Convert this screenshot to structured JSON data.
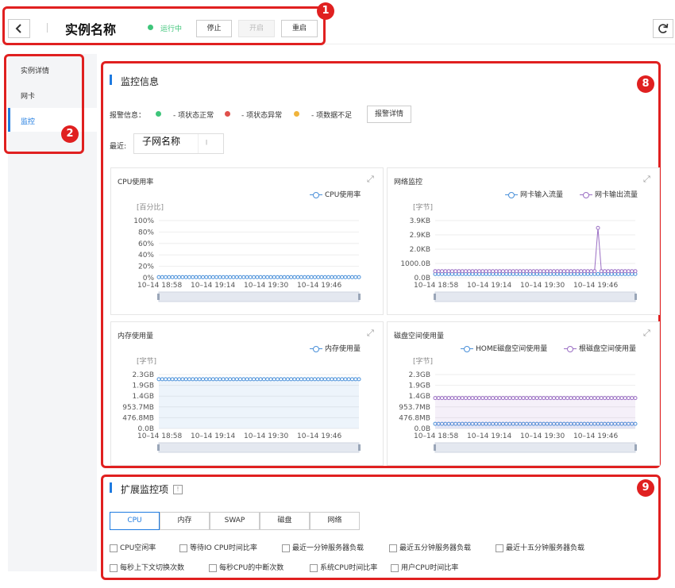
{
  "header": {
    "title": "实例名称",
    "status": "运行中",
    "status_color": "#3ec57a",
    "buttons": [
      "停止",
      "开启",
      "重启"
    ],
    "back_icon": "chevron-left-icon",
    "refresh_icon": "refresh-icon"
  },
  "sidebar": {
    "items": [
      {
        "label": "实例详情",
        "active": false
      },
      {
        "label": "网卡",
        "active": false
      },
      {
        "label": "监控",
        "active": true
      }
    ],
    "accent": "#1f7be0"
  },
  "badges": [
    "1",
    "2",
    "8",
    "9"
  ],
  "monitor": {
    "title": "监控信息",
    "alarm_label": "报警信息：",
    "legend": [
      {
        "text": "- 项状态正常",
        "color": "#3ec57a"
      },
      {
        "text": "- 项状态异常",
        "color": "#e0504b"
      },
      {
        "text": "- 项数据不足",
        "color": "#f0b43c"
      }
    ],
    "alarm_button": "报警详情",
    "recent_label": "最近:",
    "subnet_value": "子网名称"
  },
  "chart_data": [
    {
      "type": "line",
      "title": "CPU使用率",
      "ylabel": "[百分比]",
      "yticks": [
        "100%",
        "80%",
        "60%",
        "40%",
        "20%",
        "0%"
      ],
      "ylim": [
        0,
        100
      ],
      "x": [
        "10–14 18:58",
        "10–14 19:14",
        "10–14 19:30",
        "10–14 19:46"
      ],
      "series": [
        {
          "name": "CPU使用率",
          "color": "#4a90d9",
          "values": [
            1,
            1,
            1,
            1,
            1,
            1,
            1,
            1,
            1,
            1,
            1,
            1,
            1,
            1,
            1,
            1,
            1,
            1,
            1,
            1,
            1,
            1,
            1,
            1,
            1,
            1,
            1,
            1,
            1,
            1,
            1,
            1,
            1,
            1,
            1,
            1,
            1,
            1,
            1,
            1,
            1,
            1,
            1,
            1,
            1,
            1,
            1,
            1,
            1,
            1,
            1,
            1,
            1,
            1,
            1,
            1,
            1,
            1,
            1,
            1
          ]
        }
      ]
    },
    {
      "type": "line",
      "title": "网络监控",
      "ylabel": "[字节]",
      "yticks": [
        "3.9KB",
        "2.9KB",
        "2.0KB",
        "1000.0B",
        "0.0B"
      ],
      "ylim": [
        0,
        3.9
      ],
      "x": [
        "10–14 18:58",
        "10–14 19:14",
        "10–14 19:30",
        "10–14 19:46"
      ],
      "series": [
        {
          "name": "网卡输入流量",
          "color": "#4a90d9",
          "values": [
            0.25,
            0.25,
            0.25,
            0.25,
            0.25,
            0.25,
            0.25,
            0.25,
            0.25,
            0.25,
            0.25,
            0.25,
            0.25,
            0.25,
            0.25,
            0.25,
            0.25,
            0.25,
            0.25,
            0.25,
            0.25,
            0.25,
            0.25,
            0.25,
            0.25,
            0.25,
            0.25,
            0.25,
            0.25,
            0.25,
            0.25,
            0.25,
            0.25,
            0.25,
            0.25,
            0.25,
            0.25,
            0.25,
            0.25,
            0.25,
            0.25,
            0.25,
            0.25,
            0.25,
            0.25,
            0.25,
            0.25,
            0.25,
            0.25,
            0.25,
            0.25,
            0.25,
            0.25,
            0.25,
            0.25,
            0.25,
            0.25,
            0.25,
            0.25,
            0.25
          ]
        },
        {
          "name": "网卡输出流量",
          "color": "#9b6fc4",
          "values": [
            0.45,
            0.45,
            0.45,
            0.45,
            0.45,
            0.45,
            0.45,
            0.45,
            0.45,
            0.45,
            0.45,
            0.45,
            0.45,
            0.45,
            0.45,
            0.45,
            0.45,
            0.45,
            0.45,
            0.45,
            0.45,
            0.45,
            0.45,
            0.45,
            0.45,
            0.45,
            0.45,
            0.45,
            0.45,
            0.45,
            0.45,
            0.45,
            0.45,
            0.45,
            0.45,
            0.45,
            0.45,
            0.45,
            0.45,
            0.45,
            0.45,
            0.45,
            0.45,
            0.45,
            0.45,
            0.45,
            0.45,
            0.45,
            3.4,
            0.45,
            0.45,
            0.45,
            0.45,
            0.45,
            0.45,
            0.45,
            0.45,
            0.45,
            0.45,
            0.45
          ]
        }
      ]
    },
    {
      "type": "area",
      "title": "内存使用量",
      "ylabel": "[字节]",
      "yticks": [
        "2.3GB",
        "1.9GB",
        "1.4GB",
        "953.7MB",
        "476.8MB",
        "0.0B"
      ],
      "ylim": [
        0,
        2.3
      ],
      "x": [
        "10–14 18:58",
        "10–14 19:14",
        "10–14 19:30",
        "10–14 19:46"
      ],
      "series": [
        {
          "name": "内存使用量",
          "color": "#4a90d9",
          "values": [
            2.1,
            2.1,
            2.1,
            2.1,
            2.1,
            2.1,
            2.1,
            2.1,
            2.1,
            2.1,
            2.1,
            2.1,
            2.1,
            2.1,
            2.1,
            2.1,
            2.1,
            2.1,
            2.1,
            2.1,
            2.1,
            2.1,
            2.1,
            2.1,
            2.1,
            2.1,
            2.1,
            2.1,
            2.1,
            2.1,
            2.1,
            2.1,
            2.1,
            2.1,
            2.1,
            2.1,
            2.1,
            2.1,
            2.1,
            2.1,
            2.1,
            2.1,
            2.1,
            2.1,
            2.1,
            2.1,
            2.1,
            2.1,
            2.1,
            2.1,
            2.1,
            2.1,
            2.1,
            2.1,
            2.1,
            2.1,
            2.1,
            2.1,
            2.1,
            2.1
          ]
        }
      ]
    },
    {
      "type": "area",
      "title": "磁盘空间使用量",
      "ylabel": "[字节]",
      "yticks": [
        "2.3GB",
        "1.9GB",
        "1.4GB",
        "953.7MB",
        "476.8MB",
        "0.0B"
      ],
      "ylim": [
        0,
        2.3
      ],
      "x": [
        "10–14 18:58",
        "10–14 19:14",
        "10–14 19:30",
        "10–14 19:46"
      ],
      "series": [
        {
          "name": "HOME磁盘空间使用量",
          "color": "#4a90d9",
          "values": [
            0.2,
            0.2,
            0.2,
            0.2,
            0.2,
            0.2,
            0.2,
            0.2,
            0.2,
            0.2,
            0.2,
            0.2,
            0.2,
            0.2,
            0.2,
            0.2,
            0.2,
            0.2,
            0.2,
            0.2,
            0.2,
            0.2,
            0.2,
            0.2,
            0.2,
            0.2,
            0.2,
            0.2,
            0.2,
            0.2,
            0.2,
            0.2,
            0.2,
            0.2,
            0.2,
            0.2,
            0.2,
            0.2,
            0.2,
            0.2,
            0.2,
            0.2,
            0.2,
            0.2,
            0.2,
            0.2,
            0.2,
            0.2,
            0.2,
            0.2,
            0.2,
            0.2,
            0.2,
            0.2,
            0.2,
            0.2,
            0.2,
            0.2,
            0.2,
            0.2
          ]
        },
        {
          "name": "根磁盘空间使用量",
          "color": "#9b6fc4",
          "values": [
            1.3,
            1.3,
            1.3,
            1.3,
            1.3,
            1.3,
            1.3,
            1.3,
            1.3,
            1.3,
            1.3,
            1.3,
            1.3,
            1.3,
            1.3,
            1.3,
            1.3,
            1.3,
            1.3,
            1.3,
            1.3,
            1.3,
            1.3,
            1.3,
            1.3,
            1.3,
            1.3,
            1.3,
            1.3,
            1.3,
            1.3,
            1.3,
            1.3,
            1.3,
            1.3,
            1.3,
            1.3,
            1.3,
            1.3,
            1.3,
            1.3,
            1.3,
            1.3,
            1.3,
            1.3,
            1.3,
            1.3,
            1.3,
            1.3,
            1.3,
            1.3,
            1.3,
            1.3,
            1.3,
            1.3,
            1.3,
            1.3,
            1.3,
            1.3,
            1.3
          ]
        }
      ]
    }
  ],
  "extended": {
    "title": "扩展监控项",
    "tabs": [
      "CPU",
      "内存",
      "SWAP",
      "磁盘",
      "网络"
    ],
    "active_tab": 0,
    "checkboxes_row1": [
      "CPU空闲率",
      "等待IO CPU时间比率",
      "最近一分钟服务器负载",
      "最近五分钟服务器负载",
      "最近十五分钟服务器负载"
    ],
    "checkboxes_row2": [
      "每秒上下文切换次数",
      "每秒CPU的中断次数",
      "系统CPU时间比率",
      "用户CPU时间比率"
    ]
  }
}
